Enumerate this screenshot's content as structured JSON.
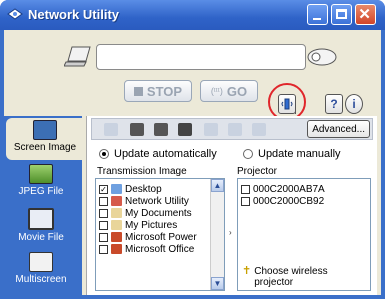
{
  "window": {
    "title": "Network Utility"
  },
  "toolbar": {
    "stop_label": "STOP",
    "go_label": "GO",
    "go_prefix": "(···)",
    "help_label": "?",
    "info_label": "i"
  },
  "sidebar": {
    "items": [
      {
        "label": "Screen Image"
      },
      {
        "label": "JPEG File"
      },
      {
        "label": "Movie File"
      },
      {
        "label": "Multiscreen"
      }
    ]
  },
  "panel": {
    "advanced_label": "Advanced...",
    "radio_auto": "Update automatically",
    "radio_manual": "Update manually",
    "transmission_label": "Transmission Image",
    "projector_label": "Projector",
    "transmission_items": [
      {
        "label": "Desktop",
        "checked": true
      },
      {
        "label": "Network Utility",
        "checked": false
      },
      {
        "label": "My Documents",
        "checked": false
      },
      {
        "label": "My Pictures",
        "checked": false
      },
      {
        "label": "Microsoft Power",
        "checked": false
      },
      {
        "label": "Microsoft Office",
        "checked": false
      }
    ],
    "projectors": [
      {
        "label": "000C2000AB7A"
      },
      {
        "label": "000C2000CB92"
      }
    ],
    "choose_hint": "Choose wireless projector",
    "hint_icon": "✝"
  },
  "colors": {
    "titlebar": "#2f63c8",
    "highlight_circle": "#e0262b",
    "sidebar": "#3a6fc9"
  }
}
